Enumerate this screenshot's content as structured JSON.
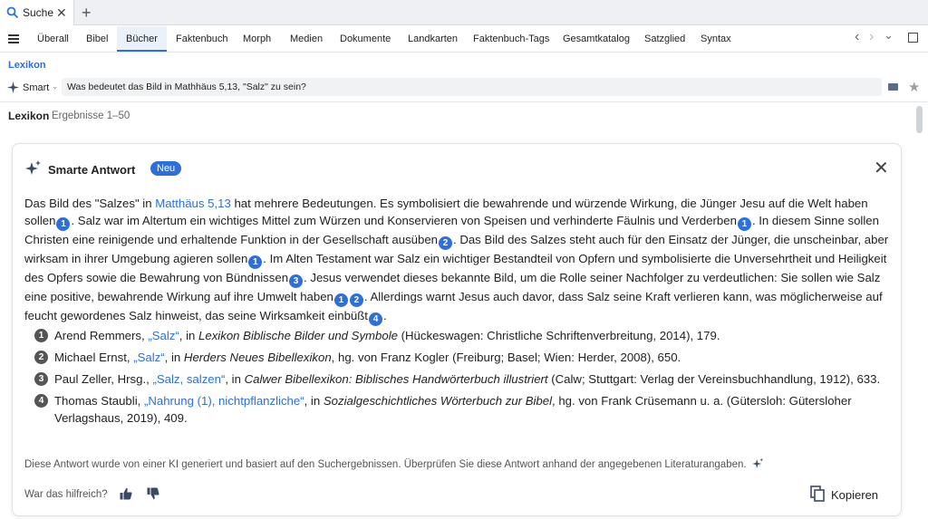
{
  "tab": {
    "title": "Suche",
    "close": "✕",
    "add": "+"
  },
  "nav": {
    "tabs": [
      "Überall",
      "Bibel",
      "Bücher",
      "Faktenbuch",
      "Morph",
      "Medien",
      "Dokumente",
      "Landkarten",
      "Faktenbuch-Tags",
      "Gesamtkatalog",
      "Satzglied",
      "Syntax"
    ],
    "active": "Bücher",
    "back": "‹",
    "forward": "›",
    "dropdown": "⌄"
  },
  "breadcrumb": "Lexikon",
  "search": {
    "mode": "Smart",
    "query": "Was bedeutet das Bild in Mathhäus 5,13, \"Salz\" zu sein?"
  },
  "results": {
    "title": "Lexikon",
    "count": "Ergebnisse 1–50"
  },
  "card": {
    "title": "Smarte Antwort",
    "badge": "Neu",
    "close": "✕",
    "answer": {
      "p1": "Das Bild des \"Salzes\" in ",
      "link": "Matthäus 5,13",
      "p2": " hat mehrere Bedeutungen. Es symbolisiert die bewahrende und würzende Wirkung, die Jünger Jesu auf die Welt haben sollen",
      "p3": ". Salz war im Altertum ein wichtiges Mittel zum Würzen und Konservieren von Speisen und verhinderte Fäulnis und Verderben",
      "p4": ". In diesem Sinne sollen Christen eine reinigende und erhaltende Funktion in der Gesellschaft ausüben",
      "p5": ". Das Bild des Salzes steht auch für den Einsatz der Jünger, die unscheinbar, aber wirksam in ihrer Umgebung agieren sollen",
      "p6": ". Im Alten Testament war Salz ein wichtiger Bestandteil von Opfern und symbolisierte die Unversehrtheit und Heiligkeit des Opfers sowie die Bewahrung von Bündnissen",
      "p7": ". Jesus verwendet dieses bekannte Bild, um die Rolle seiner Nachfolger zu verdeutlichen: Sie sollen wie Salz eine positive, bewahrende Wirkung auf ihre Umwelt haben",
      "p8": ". Allerdings warnt Jesus auch davor, dass Salz seine Kraft verlieren kann, was möglicherweise auf feucht gewordenes Salz hinweist, das seine Wirksamkeit einbüßt",
      "p9": ".",
      "cites": [
        "1",
        "1",
        "2",
        "1",
        "3",
        "1",
        "2",
        "4"
      ]
    },
    "references": [
      {
        "num": "1",
        "author": "Arend Remmers, ",
        "link": "„Salz“",
        "mid": ", in ",
        "work": "Lexikon Biblische Bilder und Symbole",
        "tail": " (Hückeswagen: Christliche Schriftenverbreitung, 2014), 179."
      },
      {
        "num": "2",
        "author": "Michael Ernst, ",
        "link": "„Salz“",
        "mid": ", in ",
        "work": "Herders Neues Bibellexikon",
        "tail": ", hg. von Franz Kogler (Freiburg; Basel; Wien: Herder, 2008), 650."
      },
      {
        "num": "3",
        "author": "Paul Zeller, Hrsg., ",
        "link": "„Salz, salzen“",
        "mid": ", in ",
        "work": "Calwer Bibellexikon: Biblisches Handwörterbuch illustriert",
        "tail": " (Calw; Stuttgart: Verlag der Vereinsbuchhandlung, 1912), 633."
      },
      {
        "num": "4",
        "author": "Thomas Staubli, ",
        "link": "„Nahrung (1), nichtpflanzliche“",
        "mid": ", in ",
        "work": "Sozialgeschichtliches Wörterbuch zur Bibel",
        "tail": ", hg. von Frank Crüsemann u. a. (Gütersloh: Gütersloher Verlagshaus, 2019), 409."
      }
    ],
    "disclaimer": "Diese Antwort wurde von einer KI generiert und basiert auf den Suchergebnissen. Überprüfen Sie diese Antwort anhand der angegebenen Literaturangaben.",
    "helpful": "War das hilfreich?",
    "copy": "Kopieren"
  },
  "colors": {
    "accent": "#2f6fd6",
    "badge": "#2f6fd6"
  }
}
